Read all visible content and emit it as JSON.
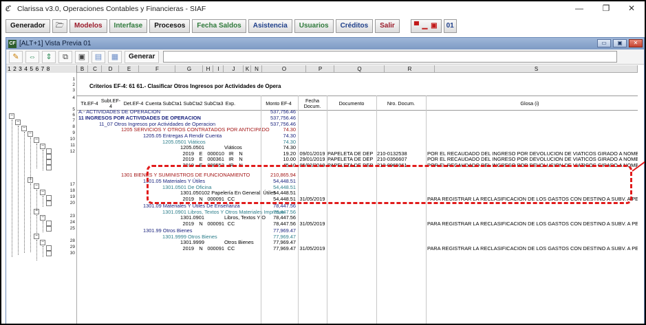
{
  "window": {
    "title": "Clarissa v3.0, Operaciones Contables y Financieras - SIAF",
    "app_icon": "ℭ",
    "controls": {
      "minimize": "—",
      "restore": "❐",
      "close": "✕"
    }
  },
  "menu": {
    "generador": "Generador",
    "open_icon": "🗁",
    "modelos": "Modelos",
    "interfase": "Interfase",
    "procesos": "Procesos",
    "fecha_saldos": "Fecha Saldos",
    "asistencia": "Asistencia",
    "usuarios": "Usuarios",
    "creditos": "Créditos",
    "salir": "Salir",
    "window_icons": "▀ ▁ ▣",
    "window_number": "01"
  },
  "inner_window": {
    "title": "[ALT+1] Vista Previa 01",
    "icon": "CF",
    "buttons": {
      "min": "▭",
      "max": "▣",
      "close": "✕"
    }
  },
  "toolbar": {
    "generar_label": "Generar",
    "icons": [
      "pencil-icon",
      "swap-horizontal-icon",
      "swap-vertical-icon",
      "copy-icon",
      "save-icon",
      "export-icon",
      "table-icon"
    ]
  },
  "levels": "1 2 3 4 5 6 7 8",
  "columns": [
    "B",
    "C",
    "D",
    "E",
    "F",
    "G",
    "H",
    "I",
    "J",
    "K",
    "N",
    "O",
    "P",
    "Q",
    "R",
    "S"
  ],
  "sheet": {
    "criteria_title": "Criterios EF-4: 61 61.- Clasificar Otros Ingresos por Actividades de Opera",
    "headers": {
      "tit": "Tit.EF-4",
      "subt": "Subt.EF-4",
      "det": "Det.EF-4",
      "cuenta": "Cuenta",
      "subcta1": "SubCta1",
      "subcta2": "SubCta2",
      "subcta3": "SubCta3",
      "exp": "Exp.",
      "monto": "Monto EF-4",
      "fecha": "Fecha Docum.",
      "documento": "Documento",
      "nro": "Nro. Docum.",
      "glosa": "Glosa (i)"
    }
  },
  "row_numbers": [
    "1",
    "2",
    "3",
    "4",
    "5",
    "6",
    "7",
    "8",
    "9",
    "10",
    "11",
    "12",
    "",
    "",
    "",
    "17",
    "18",
    "19",
    "20",
    "",
    "23",
    "24",
    "25",
    "",
    "28",
    "29",
    "30",
    ""
  ],
  "rows": [
    {
      "label": "A.- ACTIVIDADES DE OPERACION",
      "monto": "537,756.46"
    },
    {
      "label": "11    INGRESOS POR ACTIVIDADES DE OPERACION",
      "monto": "537,756.46"
    },
    {
      "label": "11_07   Otros Ingresos por Actividades de Operacion",
      "monto": "537,756.46"
    },
    {
      "label": "1205   SERVICIOS Y OTROS CONTRATADOS POR ANTICIPADO",
      "monto": "74.30"
    },
    {
      "label": "1205.05   Entregas A Rendir Cuenta",
      "monto": "74.30"
    },
    {
      "label": "1205.0501   Viáticos",
      "monto": "74.30"
    },
    {
      "label": "1205.0501",
      "label2": "Viáticos",
      "monto": "74.30"
    },
    {
      "year": "2019",
      "e": "E",
      "num": "000010",
      "ir": "IR",
      "n": "N",
      "monto": "19.20",
      "fecha": "09/01/2019",
      "documento": "PAPELETA DE DEP",
      "nro": "210-0132538",
      "glosa": "POR EL RECAUDADO DEL INGRESO POR DEVOLUCION DE VIATICOS GIRADO A NOMBRE DE"
    },
    {
      "year": "2019",
      "e": "E",
      "num": "000361",
      "ir": "IR",
      "n": "N",
      "monto": "10.00",
      "fecha": "29/01/2019",
      "documento": "PAPELETA DE DEP",
      "nro": "210-0356607",
      "glosa": "POR EL RECAUDADO DEL INGRESO POR DEVOLUCION DE VIATICOS GIRADO A NOMBRE DE"
    },
    {
      "year": "2019",
      "e": "E",
      "num": "000553",
      "ir": "IR",
      "n": "N",
      "monto": "45.10",
      "fecha": "05/02/2019",
      "documento": "PAPELETA DE DEP",
      "nro": "210-0965061",
      "glosa": "POR EL RECAUDADO DEL INGRESO POR DEVOLUCION DE VIATICOS GIRADO A NOMBRE DE"
    },
    {
      "label": "1301   BIENES Y SUMINISTROS DE FUNCIONAMIENTO",
      "monto": "210,865.94"
    },
    {
      "label": "1301.05   Materiales Y  Útiles",
      "monto": "54,448.51"
    },
    {
      "label": "1301.0501   De Oficina",
      "monto": "54,448.51"
    },
    {
      "label": "1301.050102   Papelería En General, Útiles",
      "monto": "54,448.51"
    },
    {
      "year": "2019",
      "e": "N",
      "num": "000091",
      "ir": "CC",
      "monto": "54,448.51",
      "fecha": "31/05/2019",
      "glosa": "PARA REGISTRAR LA RECLASIFICACION DE LOS GASTOS CON DESTINO A SUBV. A PERS. N"
    },
    {
      "label": "1301.09   Materiales Y Útiles De Enseñanza",
      "monto": "78,447.56"
    },
    {
      "label": "1301.0901   Libros, Textos Y Otros Materiales Impresos",
      "monto": "78,447.56"
    },
    {
      "label": "1301.0901",
      "label2": "Libros, Textos Y Otros Mater",
      "monto": "78,447.56"
    },
    {
      "year": "2019",
      "e": "N",
      "num": "000091",
      "ir": "CC",
      "monto": "78,447.56",
      "fecha": "31/05/2019",
      "glosa": "PARA REGISTRAR LA RECLASIFICACION DE LOS GASTOS CON DESTINO A SUBV. A PERS. N"
    },
    {
      "label": "1301.99   Otros Bienes",
      "monto": "77,969.47"
    },
    {
      "label": "1301.9999   Otros Bienes",
      "monto": "77,969.47"
    },
    {
      "label": "1301.9999",
      "label2": "Otros Bienes",
      "monto": "77,969.47"
    },
    {
      "year": "2019",
      "e": "N",
      "num": "000091",
      "ir": "CC",
      "monto": "77,969.47",
      "fecha": "31/05/2019",
      "glosa": "PARA REGISTRAR LA RECLASIFICACION DE LOS GASTOS CON DESTINO A SUBV. A PERS. N"
    }
  ],
  "colors": {
    "highlight": "#e11b1b",
    "blue_text": "#1a237e",
    "red_text": "#a31515",
    "teal_text": "#2a7d8a"
  }
}
